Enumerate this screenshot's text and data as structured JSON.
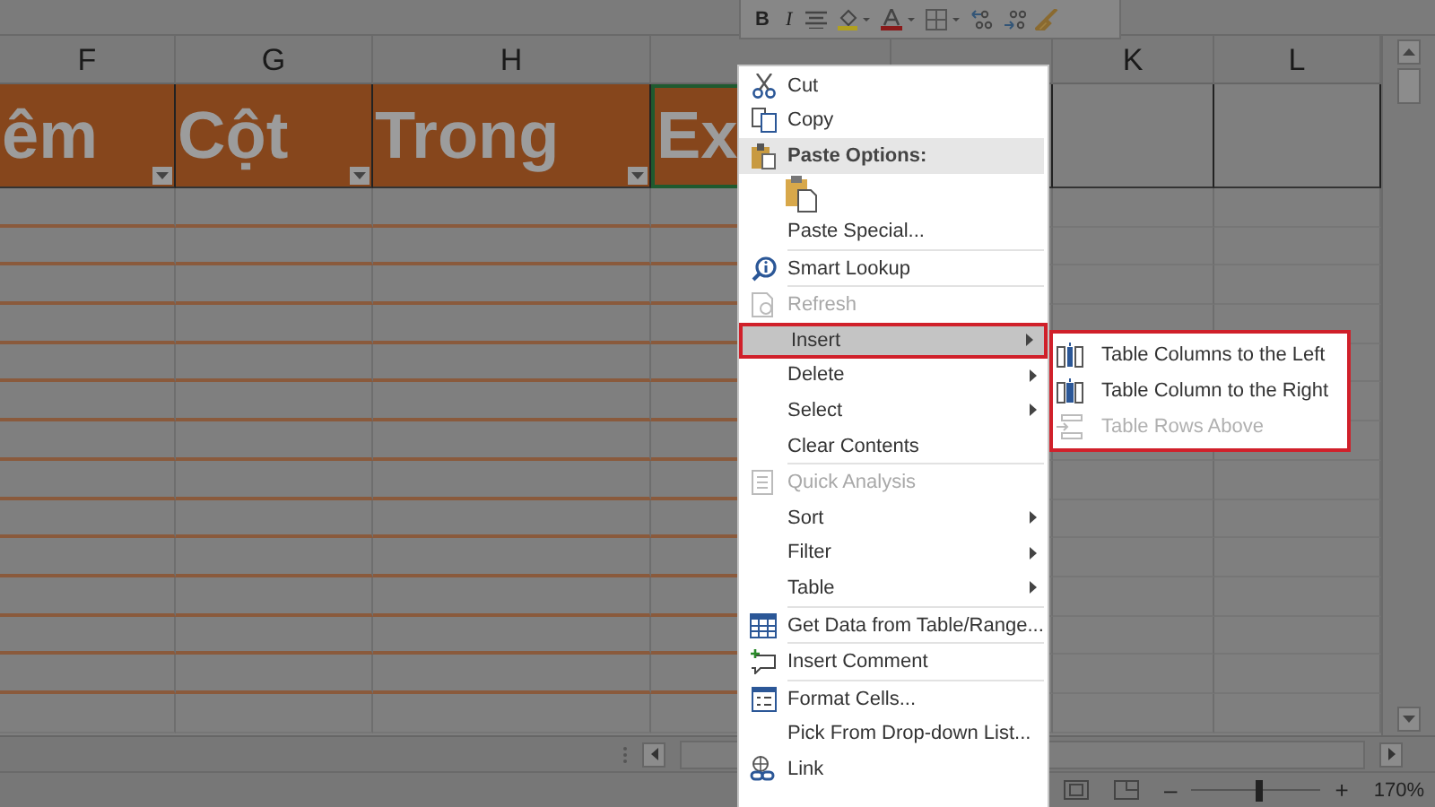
{
  "mini_toolbar": {
    "buttons": [
      {
        "kind": "bold",
        "label": "B"
      },
      {
        "kind": "italic",
        "label": "I"
      },
      {
        "kind": "align"
      },
      {
        "kind": "fill"
      },
      {
        "kind": "fontcolor"
      },
      {
        "kind": "borders"
      },
      {
        "kind": "incdec"
      },
      {
        "kind": "decdec"
      },
      {
        "kind": "painter"
      }
    ]
  },
  "columns": [
    {
      "letter": "F",
      "header": "êm",
      "filter": true,
      "selected": false
    },
    {
      "letter": "G",
      "header": "Cột",
      "filter": true,
      "selected": false
    },
    {
      "letter": "H",
      "header": "Trong",
      "filter": true,
      "selected": false
    },
    {
      "header": "Ex",
      "selected": true
    },
    {
      "selected": false
    },
    {
      "letter": "K",
      "selected": false
    },
    {
      "letter": "L",
      "selected": false
    }
  ],
  "context_menu": {
    "items": [
      {
        "kind": "item",
        "label": "Cut",
        "disabled": false,
        "selected": false,
        "submenu": false
      },
      {
        "kind": "item",
        "label": "Copy",
        "disabled": false,
        "selected": false,
        "submenu": false
      },
      {
        "kind": "header",
        "label": "Paste Options:"
      },
      {
        "kind": "paste"
      },
      {
        "kind": "item",
        "label": "Paste Special...",
        "disabled": false,
        "selected": false,
        "submenu": false
      },
      {
        "kind": "separator"
      },
      {
        "kind": "item",
        "label": "Smart Lookup",
        "disabled": false,
        "selected": false,
        "submenu": false
      },
      {
        "kind": "separator"
      },
      {
        "kind": "item",
        "label": "Refresh",
        "disabled": true,
        "selected": false,
        "submenu": false
      },
      {
        "kind": "item",
        "label": "Insert",
        "disabled": false,
        "selected": true,
        "submenu": true
      },
      {
        "kind": "item",
        "label": "Delete",
        "disabled": false,
        "selected": false,
        "submenu": true
      },
      {
        "kind": "item",
        "label": "Select",
        "disabled": false,
        "selected": false,
        "submenu": true
      },
      {
        "kind": "item",
        "label": "Clear Contents",
        "disabled": false,
        "selected": false,
        "submenu": false
      },
      {
        "kind": "separator"
      },
      {
        "kind": "item",
        "label": "Quick Analysis",
        "disabled": true,
        "selected": false,
        "submenu": false
      },
      {
        "kind": "item",
        "label": "Sort",
        "disabled": false,
        "selected": false,
        "submenu": true
      },
      {
        "kind": "item",
        "label": "Filter",
        "disabled": false,
        "selected": false,
        "submenu": true
      },
      {
        "kind": "item",
        "label": "Table",
        "disabled": false,
        "selected": false,
        "submenu": true
      },
      {
        "kind": "separator"
      },
      {
        "kind": "item",
        "label": "Get Data from Table/Range...",
        "disabled": false,
        "selected": false,
        "submenu": false
      },
      {
        "kind": "separator"
      },
      {
        "kind": "item",
        "label": "Insert Comment",
        "disabled": false,
        "selected": false,
        "submenu": false
      },
      {
        "kind": "separator"
      },
      {
        "kind": "item",
        "label": "Format Cells...",
        "disabled": false,
        "selected": false,
        "submenu": false
      },
      {
        "kind": "item",
        "label": "Pick From Drop-down List...",
        "disabled": false,
        "selected": false,
        "submenu": false
      },
      {
        "kind": "item",
        "label": "Link",
        "disabled": false,
        "selected": false,
        "submenu": false
      }
    ]
  },
  "submenu": {
    "items": [
      {
        "label": "Table Columns to the Left",
        "disabled": false
      },
      {
        "label": "Table Column to the Right",
        "disabled": false
      },
      {
        "label": "Table Rows Above",
        "disabled": true
      }
    ]
  },
  "status_bar": {
    "zoom_out": "–",
    "zoom_in": "+",
    "zoom": "170%",
    "level": 0.5
  }
}
